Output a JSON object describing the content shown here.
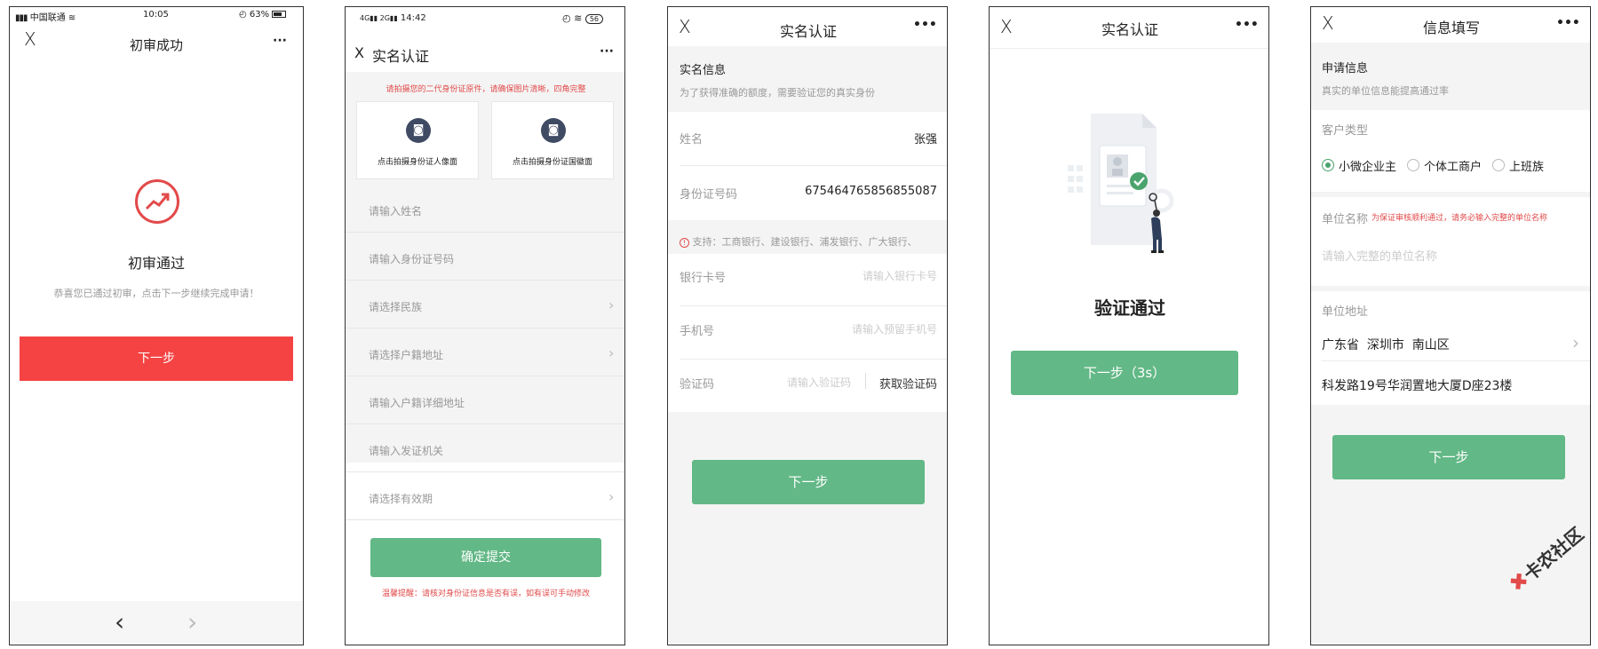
{
  "screen1": {
    "status_carrier": "中国联通",
    "status_time": "10:05",
    "status_battery": "63%",
    "close_glyph": "X",
    "title": "初审成功",
    "more_glyph": "···",
    "result_title": "初审通过",
    "result_desc": "恭喜您已通过初审，点击下一步继续完成申请！",
    "next_label": "下一步",
    "back_glyph": "‹",
    "forward_glyph": "›"
  },
  "screen2": {
    "status_time": "14:42",
    "status_battery": "56",
    "close_glyph": "X",
    "title": "实名认证",
    "more_glyph": "···",
    "notice": "请拍摄您的二代身份证原件，请确保图片清晰，四角完整",
    "front_label": "点击拍摄身份证人像面",
    "back_label": "点击拍摄身份证国徽面",
    "fields": [
      {
        "placeholder": "请输入姓名",
        "chevron": false
      },
      {
        "placeholder": "请输入身份证号码",
        "chevron": false
      },
      {
        "placeholder": "请选择民族",
        "chevron": true
      },
      {
        "placeholder": "请选择户籍地址",
        "chevron": true
      },
      {
        "placeholder": "请输入户籍详细地址",
        "chevron": false
      },
      {
        "placeholder": "请输入发证机关",
        "chevron": false
      },
      {
        "placeholder": "请选择有效期",
        "chevron": true
      }
    ],
    "submit_label": "确定提交",
    "tip": "温馨提醒：请核对身份证信息是否有误，如有误可手动修改"
  },
  "screen3": {
    "close_glyph": "X",
    "title": "实名认证",
    "more_glyph": "•••",
    "section_title": "实名信息",
    "section_desc": "为了获得准确的额度，需要验证您的真实身份",
    "name_label": "姓名",
    "name_value": "张强",
    "id_label": "身份证号码",
    "id_value": "675464765856855087",
    "support_text": "支持：工商银行、建设银行、浦发银行、广大银行、",
    "card_label": "银行卡号",
    "card_placeholder": "请输入银行卡号",
    "phone_label": "手机号",
    "phone_placeholder": "请输入预留手机号",
    "code_label": "验证码",
    "code_placeholder": "请输入验证码",
    "get_code_label": "获取验证码",
    "next_label": "下一步"
  },
  "screen4": {
    "close_glyph": "X",
    "title": "实名认证",
    "more_glyph": "•••",
    "result_title": "验证通过",
    "next_label": "下一步（3s）"
  },
  "screen5": {
    "close_glyph": "X",
    "title": "信息填写",
    "more_glyph": "•••",
    "section_title": "申请信息",
    "section_desc": "真实的单位信息能提高通过率",
    "customer_type_label": "客户类型",
    "customer_types": [
      {
        "label": "小微企业主",
        "selected": true
      },
      {
        "label": "个体工商户",
        "selected": false
      },
      {
        "label": "上班族",
        "selected": false
      }
    ],
    "company_label": "单位名称",
    "company_hint": "为保证审核顺利通过，请务必输入完整的单位名称",
    "company_placeholder": "请输入完整的单位名称",
    "address_label": "单位地址",
    "address_region": "广东省  深圳市  南山区",
    "address_detail": "科发路19号华润置地大厦D座23楼",
    "next_label": "下一步"
  },
  "watermark": "卡农社区",
  "colors": {
    "red": "#f54343",
    "green": "#62b886",
    "radio_green": "#4aa36d",
    "hint_red": "#e24a4a"
  }
}
